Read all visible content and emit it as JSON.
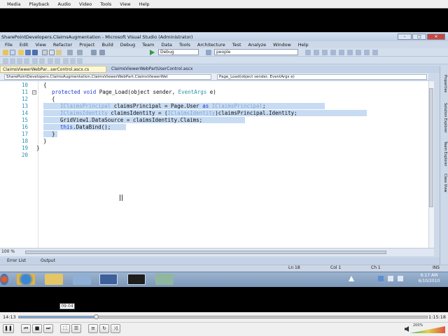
{
  "player": {
    "menu": [
      "Media",
      "Playback",
      "Audio",
      "Video",
      "Tools",
      "View",
      "Help"
    ],
    "tooltip_time": "09:04",
    "elapsed": "14:13",
    "total": "1:15:18",
    "progress": 0.19,
    "volume": "200%"
  },
  "vs": {
    "title": "SharePointDevelopers.ClaimsAugmentation - Microsoft Visual Studio (Administrator)",
    "menu": [
      "File",
      "Edit",
      "View",
      "Refactor",
      "Project",
      "Build",
      "Debug",
      "Team",
      "Data",
      "Tools",
      "Architecture",
      "Test",
      "Analyze",
      "Window",
      "Help"
    ],
    "config": "Debug",
    "search": "people",
    "tabs": [
      "ClaimsViewerWebPar...serControl.ascx.cs",
      "ClaimsViewerWebPartUserControl.ascx"
    ],
    "nav_left": "SharePointDevelopers.ClaimsAugmentation.ClaimsViewerWebPart.ClaimsViewerWel",
    "nav_right": "Page_Load(object sender, EventArgs e)",
    "zoom": "100 %",
    "dock_tabs": [
      "Properties",
      "Solution Explorer",
      "Team Explorer",
      "Class View"
    ],
    "output_tabs": [
      "Error List",
      "Output"
    ],
    "status": {
      "ln": "Ln 18",
      "col": "Col 1",
      "ch": "Ch 1",
      "mode": "INS"
    },
    "clock": {
      "time": "6:17 AM",
      "date": "6/10/2010"
    }
  },
  "code": {
    "lines": [
      {
        "num": "10",
        "text": "{"
      },
      {
        "num": "11",
        "kw": "protected void",
        "rest": " Page_Load(object sender, ",
        "type": "EventArgs",
        "end": " e)"
      },
      {
        "num": "12",
        "text": "{"
      },
      {
        "num": "13",
        "text": "IClaimsPrincipal claimsPrincipal = Page.User as IClaimsPrincipal;"
      },
      {
        "num": "14",
        "text": "IClaimsIdentity claimsIdentity = (IClaimsIdentity)claimsPrincipal.Identity;"
      },
      {
        "num": "15",
        "text": "GridView1.DataSource = claimsIdentity.Claims;"
      },
      {
        "num": "16",
        "text": "this.DataBind();"
      },
      {
        "num": "17",
        "text": "}"
      },
      {
        "num": "18",
        "text": "}"
      },
      {
        "num": "19",
        "text": "}"
      },
      {
        "num": "20",
        "text": ""
      }
    ]
  }
}
